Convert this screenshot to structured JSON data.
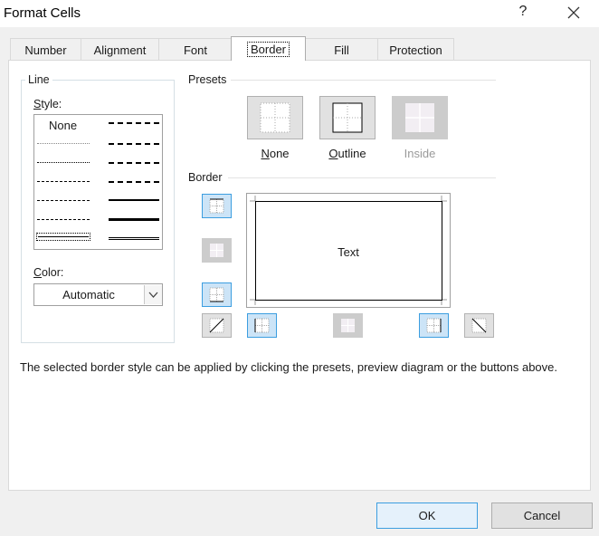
{
  "window": {
    "title": "Format Cells",
    "help": "?"
  },
  "tabs": [
    {
      "label": "Number"
    },
    {
      "label": "Alignment"
    },
    {
      "label": "Font"
    },
    {
      "label": "Border",
      "active": true
    },
    {
      "label": "Fill"
    },
    {
      "label": "Protection"
    }
  ],
  "line": {
    "group_label": "Line",
    "style_label_u": "S",
    "style_label_rest": "tyle:",
    "none_label": "None",
    "color_label_u": "C",
    "color_label_rest": "olor:",
    "color_value": "Automatic"
  },
  "presets": {
    "group_label": "Presets",
    "none": {
      "u": "N",
      "rest": "one"
    },
    "outline": {
      "u": "O",
      "rest": "utline"
    },
    "inside": {
      "label": "Inside"
    }
  },
  "border": {
    "group_label": "Border",
    "preview_text": "Text"
  },
  "hint": "The selected border style can be applied by clicking the presets, preview diagram or the buttons above.",
  "buttons": {
    "ok": "OK",
    "cancel": "Cancel"
  },
  "colors": {
    "accent": "#3c9ee0",
    "accent_fill": "#cce4f7",
    "disabled": "#cccccc"
  }
}
